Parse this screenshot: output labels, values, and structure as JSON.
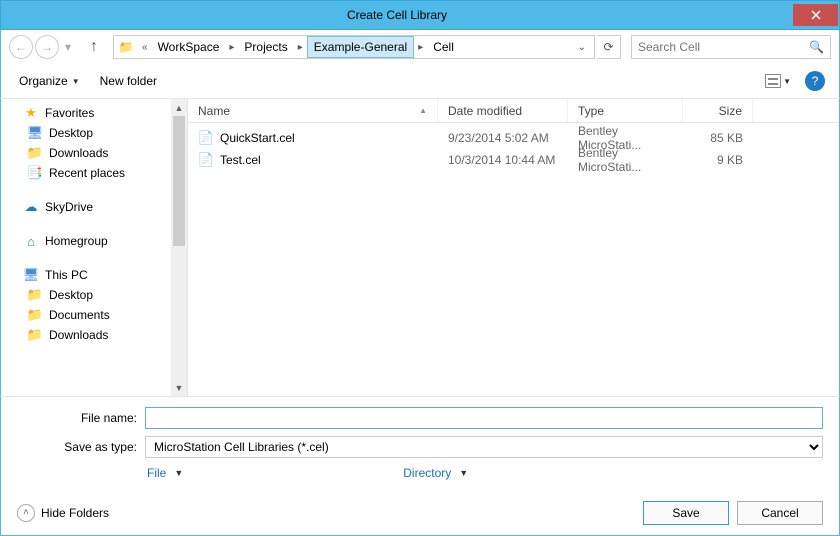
{
  "window": {
    "title": "Create Cell Library"
  },
  "nav": {
    "segments": [
      "WorkSpace",
      "Projects",
      "Example-General",
      "Cell"
    ],
    "current_index": 2
  },
  "search": {
    "placeholder": "Search Cell"
  },
  "toolbar": {
    "organize": "Organize",
    "new_folder": "New folder"
  },
  "tree": {
    "favorites": {
      "label": "Favorites",
      "items": [
        "Desktop",
        "Downloads",
        "Recent places"
      ]
    },
    "skydrive": {
      "label": "SkyDrive"
    },
    "homegroup": {
      "label": "Homegroup"
    },
    "thispc": {
      "label": "This PC",
      "items": [
        "Desktop",
        "Documents",
        "Downloads"
      ]
    }
  },
  "filelist": {
    "headers": {
      "name": "Name",
      "date": "Date modified",
      "type": "Type",
      "size": "Size"
    },
    "rows": [
      {
        "name": "QuickStart.cel",
        "date": "9/23/2014 5:02 AM",
        "type": "Bentley MicroStati...",
        "size": "85 KB"
      },
      {
        "name": "Test.cel",
        "date": "10/3/2014 10:44 AM",
        "type": "Bentley MicroStati...",
        "size": "9 KB"
      }
    ]
  },
  "form": {
    "file_name_label": "File name:",
    "file_name_value": "",
    "save_type_label": "Save as type:",
    "save_type_value": "MicroStation Cell Libraries (*.cel)",
    "file_link": "File",
    "directory_link": "Directory"
  },
  "footer": {
    "hide_folders": "Hide Folders",
    "save": "Save",
    "cancel": "Cancel"
  }
}
